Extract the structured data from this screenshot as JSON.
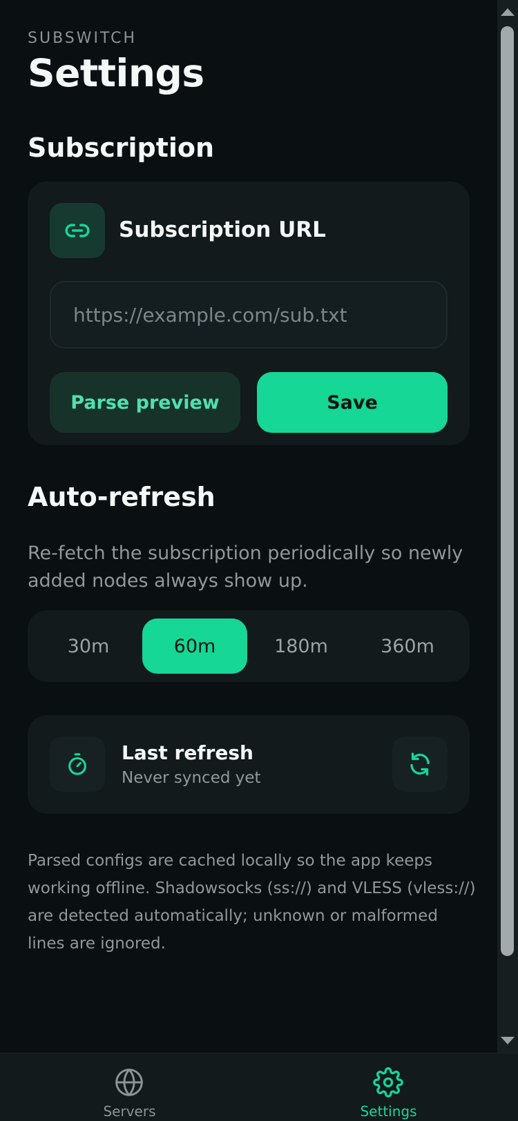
{
  "header": {
    "app_name": "SUBSWITCH",
    "title": "Settings"
  },
  "subscription": {
    "section_title": "Subscription",
    "card_label": "Subscription URL",
    "icon": "link-icon",
    "url_value": "",
    "url_placeholder": "https://example.com/sub.txt",
    "preview_button": "Parse preview",
    "save_button": "Save"
  },
  "auto_refresh": {
    "section_title": "Auto-refresh",
    "description": "Re-fetch the subscription periodically so newly added nodes always show up.",
    "options": [
      "30m",
      "60m",
      "180m",
      "360m"
    ],
    "selected": "60m"
  },
  "last_refresh": {
    "title": "Last refresh",
    "status": "Never synced yet",
    "icon": "stopwatch-icon",
    "action_icon": "refresh-icon"
  },
  "footnote": "Parsed configs are cached locally so the app keeps working offline. Shadowsocks (ss://) and VLESS (vless://) are detected automatically; unknown or malformed lines are ignored.",
  "nav": {
    "items": [
      {
        "label": "Servers",
        "icon": "globe-icon",
        "active": false
      },
      {
        "label": "Settings",
        "icon": "gear-icon",
        "active": true
      }
    ]
  },
  "colors": {
    "accent": "#16d796",
    "background": "#0a0f11",
    "card": "#121a1c",
    "muted_text": "#8f9a98"
  }
}
